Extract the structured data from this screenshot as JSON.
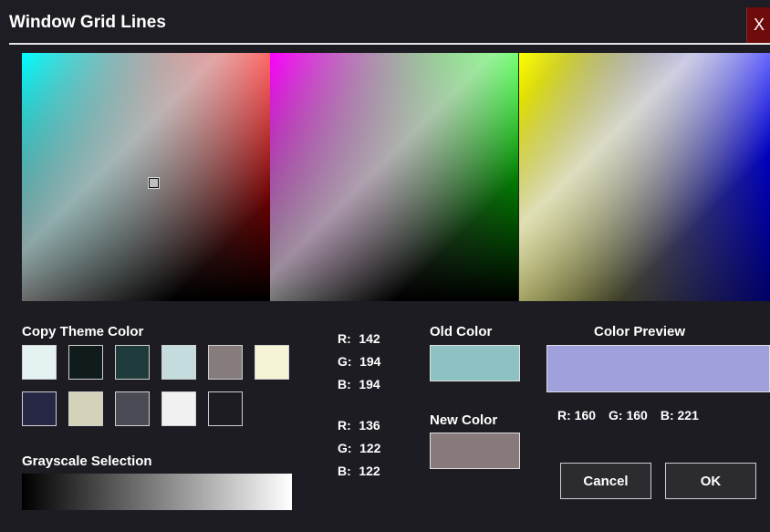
{
  "window": {
    "title": "Window Grid Lines",
    "close_label": "X"
  },
  "theme": {
    "label": "Copy Theme Color",
    "swatches_row1": [
      {
        "color": "#e4f2f1"
      },
      {
        "color": "#101b1c"
      },
      {
        "color": "#1f3b3b"
      },
      {
        "color": "#c5dcde"
      },
      {
        "color": "#877c7c"
      },
      {
        "color": "#f5f4d6"
      }
    ],
    "swatches_row2": [
      {
        "color": "#272845"
      },
      {
        "color": "#d4d2b8"
      },
      {
        "color": "#4a4b55"
      },
      {
        "color": "#f1f1f1"
      },
      {
        "color": "#1c1c22"
      }
    ]
  },
  "grayscale": {
    "label": "Grayscale Selection"
  },
  "old_color": {
    "label": "Old Color",
    "color": "#8ec2c2",
    "r_label": "R:",
    "r": "142",
    "g_label": "G:",
    "g": "194",
    "b_label": "B:",
    "b": "194"
  },
  "new_color": {
    "label": "New Color",
    "color": "#887a7a",
    "r_label": "R:",
    "r": "136",
    "g_label": "G:",
    "g": "122",
    "b_label": "B:",
    "b": "122"
  },
  "preview": {
    "label": "Color Preview",
    "color": "#a0a0dd",
    "r_label": "R:",
    "r": "160",
    "g_label": "G:",
    "g": "160",
    "b_label": "B:",
    "b": "221"
  },
  "buttons": {
    "cancel": "Cancel",
    "ok": "OK"
  }
}
